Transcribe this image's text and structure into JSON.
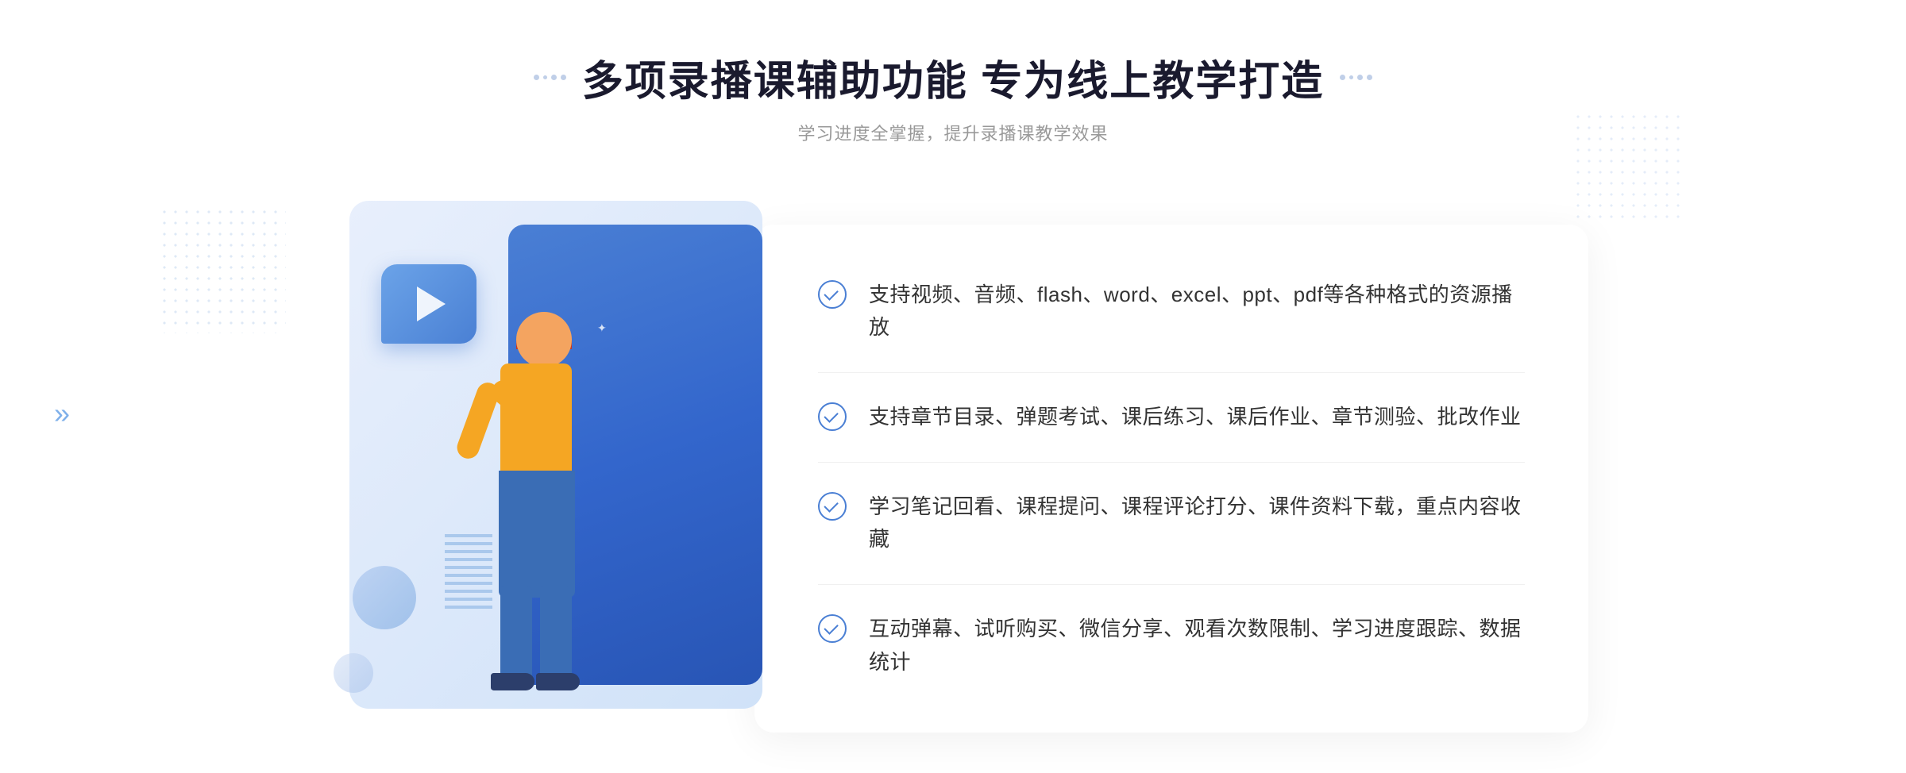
{
  "header": {
    "decorator_left": "decorators",
    "decorator_right": "decorators",
    "main_title": "多项录播课辅助功能 专为线上教学打造",
    "subtitle": "学习进度全掌握，提升录播课教学效果"
  },
  "features": [
    {
      "id": 1,
      "text": "支持视频、音频、flash、word、excel、ppt、pdf等各种格式的资源播放"
    },
    {
      "id": 2,
      "text": "支持章节目录、弹题考试、课后练习、课后作业、章节测验、批改作业"
    },
    {
      "id": 3,
      "text": "学习笔记回看、课程提问、课程评论打分、课件资料下载，重点内容收藏"
    },
    {
      "id": 4,
      "text": "互动弹幕、试听购买、微信分享、观看次数限制、学习进度跟踪、数据统计"
    }
  ],
  "colors": {
    "accent_blue": "#4a7fd4",
    "dark_blue": "#3366cc",
    "text_dark": "#333333",
    "text_light": "#999999",
    "bg_white": "#ffffff",
    "bg_light": "#f5f8ff"
  },
  "chevron": "»"
}
